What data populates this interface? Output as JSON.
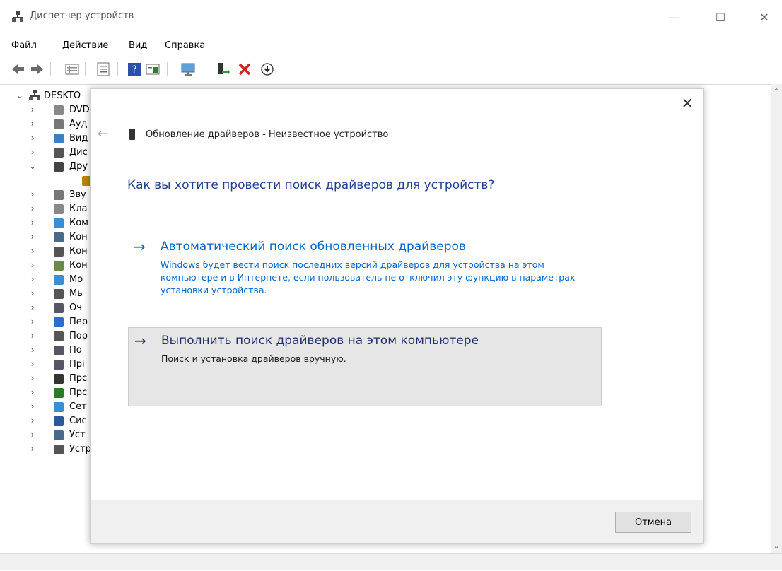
{
  "window": {
    "title": "Диспетчер устройств",
    "minimize": "—",
    "maximize": "☐",
    "close": "✕"
  },
  "menu": [
    "Файл",
    "Действие",
    "Вид",
    "Справка"
  ],
  "toolbar": {
    "icons": [
      "back-icon",
      "forward-icon",
      "properties-grid-icon",
      "list-icon",
      "help-icon",
      "view-icon",
      "monitor-icon",
      "scan-hardware-icon",
      "uninstall-icon",
      "update-driver-icon"
    ]
  },
  "tree": {
    "root": "DESKTO",
    "items": [
      {
        "label": "DVD",
        "chev": "›"
      },
      {
        "label": "Ауд",
        "chev": "›"
      },
      {
        "label": "Вид",
        "chev": "›"
      },
      {
        "label": "Дис",
        "chev": "›"
      },
      {
        "label": "Дру",
        "chev": "⌄"
      },
      {
        "label": "",
        "chev": ""
      },
      {
        "label": "Зву",
        "chev": "›"
      },
      {
        "label": "Кла",
        "chev": "›"
      },
      {
        "label": "Ком",
        "chev": "›"
      },
      {
        "label": "Кон",
        "chev": "›"
      },
      {
        "label": "Кон",
        "chev": "›"
      },
      {
        "label": "Кон",
        "chev": "›"
      },
      {
        "label": "Мо",
        "chev": "›"
      },
      {
        "label": "Мь",
        "chev": "›"
      },
      {
        "label": "Оч",
        "chev": "›"
      },
      {
        "label": "Пер",
        "chev": "›"
      },
      {
        "label": "Пор",
        "chev": "›"
      },
      {
        "label": "По",
        "chev": "›"
      },
      {
        "label": "Прі",
        "chev": "›"
      },
      {
        "label": "Прс",
        "chev": "›"
      },
      {
        "label": "Прс",
        "chev": "›"
      },
      {
        "label": "Сет",
        "chev": "›"
      },
      {
        "label": "Сис",
        "chev": "›"
      },
      {
        "label": "Уст",
        "chev": "›"
      },
      {
        "label": "Устройства обработки изображений",
        "chev": "›"
      }
    ]
  },
  "dialog": {
    "header": "Обновление драйверов - Неизвестное устройство",
    "question": "Как вы хотите провести поиск драйверов для устройств?",
    "back": "←",
    "close": "✕",
    "option1": {
      "arrow": "→",
      "title": "Автоматический поиск обновленных драйверов",
      "desc": "Windows будет вести поиск последних версий драйверов для устройства на этом компьютере и в Интернете, если пользователь не отключил эту функцию в параметрах установки устройства."
    },
    "option2": {
      "arrow": "→",
      "title": "Выполнить поиск драйверов на этом компьютере",
      "desc": "Поиск и установка драйверов вручную."
    },
    "cancel": "Отмена"
  },
  "colors": {
    "link": "#0066cc",
    "question": "#1f3f8f",
    "selected_bg": "#e6e6e6"
  }
}
